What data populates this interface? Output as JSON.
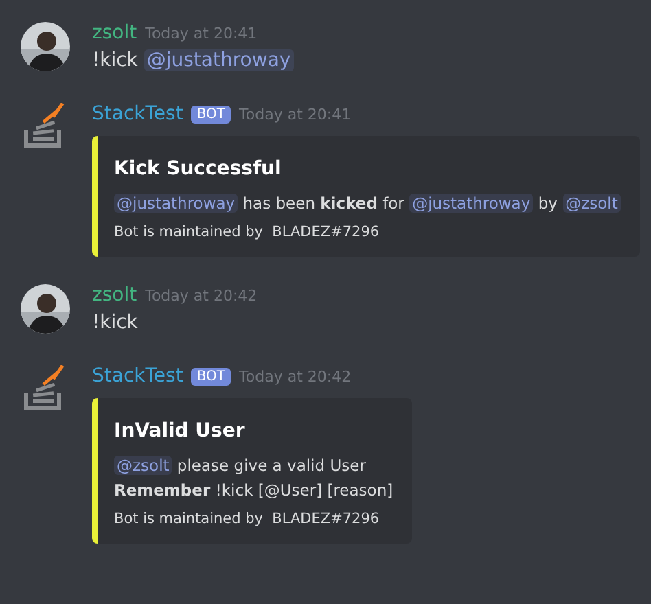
{
  "messages": [
    {
      "author": "zsolt",
      "kind": "user",
      "time": "Today at 20:41",
      "content": [
        {
          "kind": "text",
          "text": "!kick"
        },
        {
          "kind": "mention",
          "text": "@justathroway"
        }
      ]
    },
    {
      "author": "StackTest",
      "kind": "bot",
      "badge": "BOT",
      "time": "Today at 20:41",
      "embed": {
        "title": "Kick Successful",
        "lines": [
          [
            {
              "kind": "mention",
              "text": "@justathroway"
            },
            {
              "kind": "text",
              "text": "has been **kicked** for"
            },
            {
              "kind": "mention",
              "text": "@justathroway"
            },
            {
              "kind": "text",
              "text": "by"
            },
            {
              "kind": "mention",
              "text": "@zsolt"
            }
          ]
        ],
        "footer": "Bot is maintained by  BLADEZ#7296"
      }
    },
    {
      "author": "zsolt",
      "kind": "user",
      "time": "Today at 20:42",
      "content": [
        {
          "kind": "text",
          "text": "!kick"
        }
      ]
    },
    {
      "author": "StackTest",
      "kind": "bot",
      "badge": "BOT",
      "time": "Today at 20:42",
      "embed": {
        "title": "InValid User",
        "lines": [
          [
            {
              "kind": "mention",
              "text": "@zsolt"
            },
            {
              "kind": "text",
              "text": "please give a valid User"
            }
          ],
          [
            {
              "kind": "text",
              "text": "**Remember** !kick [@User] [reason]"
            }
          ]
        ],
        "footer": "Bot is maintained by  BLADEZ#7296"
      }
    }
  ]
}
